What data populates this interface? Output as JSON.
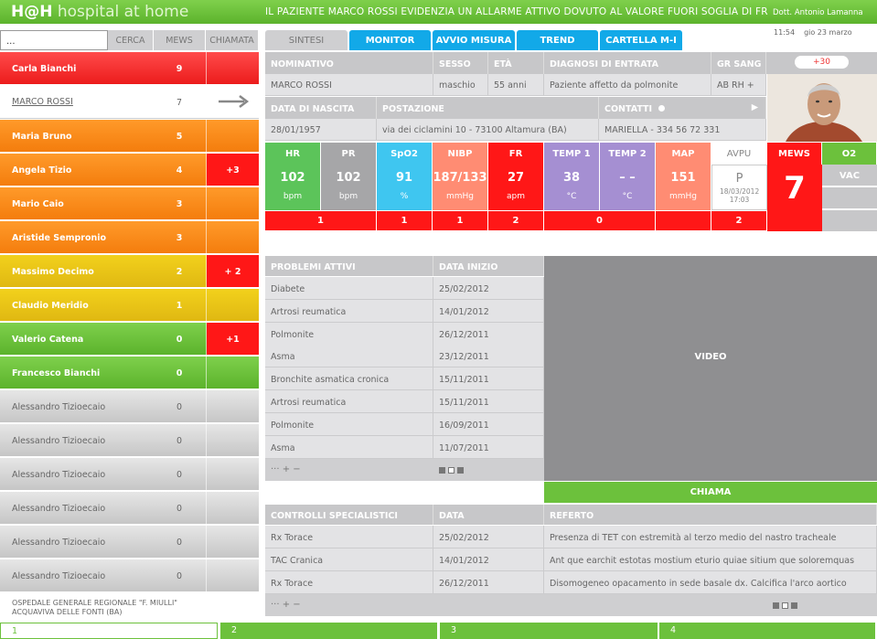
{
  "app": {
    "brand_bold": "H@H",
    "brand_light": "hospital at home",
    "alarm": "IL PAZIENTE MARCO ROSSI EVIDENZIA UN ALLARME ATTIVO DOVUTO AL VALORE FUORI SOGLIA DI FR",
    "doctor": "Dott. Antonio Lamanna",
    "time": "11:54",
    "date": "gio 23 marzo"
  },
  "list": {
    "search_value": "...",
    "search_btn": "CERCA",
    "col_mews": "MEWS",
    "col_call": "CHIAMATA",
    "patients": [
      {
        "name": "Carla Bianchi",
        "mews": "9",
        "call": ""
      },
      {
        "name": "MARCO ROSSI",
        "mews": "7",
        "call": ""
      },
      {
        "name": "Maria Bruno",
        "mews": "5",
        "call": ""
      },
      {
        "name": "Angela Tizio",
        "mews": "4",
        "call": "+3"
      },
      {
        "name": "Mario Caio",
        "mews": "3",
        "call": ""
      },
      {
        "name": "Aristide Sempronio",
        "mews": "3",
        "call": ""
      },
      {
        "name": "Massimo Decimo",
        "mews": "2",
        "call": "+ 2"
      },
      {
        "name": "Claudio Meridio",
        "mews": "1",
        "call": ""
      },
      {
        "name": "Valerio Catena",
        "mews": "0",
        "call": "+1"
      },
      {
        "name": "Francesco Bianchi",
        "mews": "0",
        "call": ""
      },
      {
        "name": "Alessandro Tizioecaio",
        "mews": "0",
        "call": ""
      },
      {
        "name": "Alessandro Tizioecaio",
        "mews": "0",
        "call": ""
      },
      {
        "name": "Alessandro Tizioecaio",
        "mews": "0",
        "call": ""
      },
      {
        "name": "Alessandro Tizioecaio",
        "mews": "0",
        "call": ""
      },
      {
        "name": "Alessandro Tizioecaio",
        "mews": "0",
        "call": ""
      },
      {
        "name": "Alessandro Tizioecaio",
        "mews": "0",
        "call": ""
      }
    ],
    "hospital_line1": "OSPEDALE GENERALE REGIONALE \"F. MIULLI\"",
    "hospital_line2": "ACQUAVIVA DELLE FONTI (BA)"
  },
  "tabs": [
    "SINTESI",
    "MONITOR",
    "AVVIO MISURA",
    "TREND",
    "CARTELLA M-I"
  ],
  "patient": {
    "h_name": "NOMINATIVO",
    "h_sex": "SESSO",
    "h_age": "ETÀ",
    "h_diag": "DIAGNOSI DI ENTRATA",
    "h_blood": "GR SANG",
    "badge": "+30",
    "name": "MARCO ROSSI",
    "sex": "maschio",
    "age": "55 anni",
    "diag": "Paziente affetto da polmonite",
    "blood": "AB RH +",
    "h_birth": "DATA DI NASCITA",
    "h_station": "POSTAZIONE",
    "h_contacts": "CONTATTI",
    "birth": "28/01/1957",
    "station": "via dei ciclamini 10 - 73100 Altamura (BA)",
    "contact": "MARIELLA - 334 56 72 331"
  },
  "vitals": [
    {
      "label": "HR",
      "value": "102",
      "unit": "bpm",
      "color": "#5cc45a",
      "score": "1"
    },
    {
      "label": "PR",
      "value": "102",
      "unit": "bpm",
      "color": "#a6a6a8",
      "score": ""
    },
    {
      "label": "SpO2",
      "value": "91",
      "unit": "%",
      "color": "#3fc6f0",
      "score": "1"
    },
    {
      "label": "NIBP",
      "value": "187/133",
      "unit": "mmHg",
      "color": "#ff8c73",
      "score": "1"
    },
    {
      "label": "FR",
      "value": "27",
      "unit": "apm",
      "color": "#ff1717",
      "score": "2"
    },
    {
      "label": "TEMP 1",
      "value": "38",
      "unit": "°C",
      "color": "#a58fd2",
      "score": "0"
    },
    {
      "label": "TEMP 2",
      "value": "– –",
      "unit": "°C",
      "color": "#a58fd2",
      "score": ""
    },
    {
      "label": "MAP",
      "value": "151",
      "unit": "mmHg",
      "color": "#ff8c73",
      "score": ""
    },
    {
      "label": "AVPU",
      "value": "P",
      "unit": "18/03/2012 17:03",
      "color": "#ffffff",
      "score": "2"
    }
  ],
  "mews": {
    "label": "MEWS",
    "value": "7",
    "o2_label": "O2",
    "o2_value": "VAC"
  },
  "problems": {
    "h1": "PROBLEMI ATTIVI",
    "h2": "DATA INIZIO",
    "rows": [
      {
        "p": "Diabete",
        "d": "25/02/2012"
      },
      {
        "p": "Artrosi reumatica",
        "d": "14/01/2012"
      },
      {
        "p": "Polmonite",
        "d": "26/12/2011"
      },
      {
        "p": "Asma",
        "d": "23/12/2011"
      },
      {
        "p": "Bronchite asmatica cronica",
        "d": "15/11/2011"
      },
      {
        "p": "Artrosi reumatica",
        "d": "15/11/2011"
      },
      {
        "p": "Polmonite",
        "d": "16/09/2011"
      },
      {
        "p": "Asma",
        "d": "11/07/2011"
      }
    ],
    "tools": "···  +  −"
  },
  "video": {
    "label": "VIDEO",
    "call": "CHIAMA"
  },
  "controls": {
    "h1": "CONTROLLI SPECIALISTICI",
    "h2": "DATA",
    "h3": "REFERTO",
    "rows": [
      {
        "c": "Rx Torace",
        "d": "25/02/2012",
        "r": "Presenza di TET con estremità al terzo medio del nastro tracheale"
      },
      {
        "c": "TAC Cranica",
        "d": "14/01/2012",
        "r": "Ant que earchit estotas mostium eturio quiae sitium que soloremquas"
      },
      {
        "c": "Rx Torace",
        "d": "26/12/2011",
        "r": "Disomogeneo opacamento in sede basale dx. Calcifica l'arco aortico"
      }
    ],
    "tools": "···  +  −"
  },
  "bottom_tabs": [
    "1",
    "2",
    "3",
    "4"
  ]
}
